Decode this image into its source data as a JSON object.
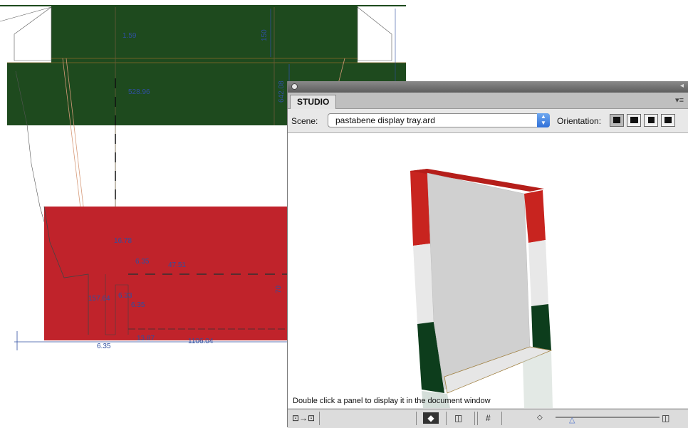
{
  "drawing": {
    "colors": {
      "green": "#1e4a1e",
      "red": "#c0232b",
      "line": "#2f4fa0"
    },
    "dimensions": [
      "1.59",
      "150",
      "528.96",
      "642.08",
      "16.78",
      "6.35",
      "47.51",
      "157.64",
      "6.33",
      "6.35",
      "70",
      "6.35",
      "13.87",
      "1106.04"
    ]
  },
  "studio": {
    "tab_label": "STUDIO",
    "scene_label": "Scene:",
    "scene_value": "pastabene display tray.ard",
    "orientation_label": "Orientation:",
    "status_text": "Double click a panel to display it in the document window",
    "model_colors": {
      "red": "#c8241f",
      "white": "#e8e8e8",
      "green": "#0d3d1c",
      "tray": "#d4d4d4"
    }
  }
}
